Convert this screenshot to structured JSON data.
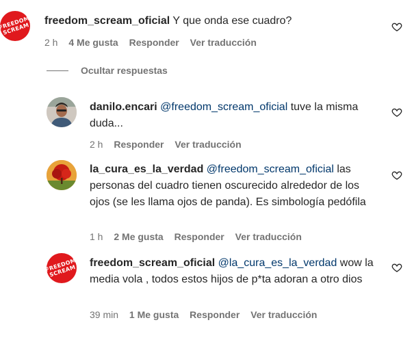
{
  "comments": [
    {
      "username": "freedom_scream_oficial",
      "mention": "",
      "text": "Y que onda ese cuadro?",
      "time": "2 h",
      "likes": "4 Me gusta",
      "reply": "Responder",
      "translate": "Ver traducción",
      "avatar": "freedom-scream-logo",
      "avatar_text": "FREEDOM SCREAM"
    },
    {
      "username": "danilo.encari",
      "mention": "@freedom_scream_oficial",
      "text": "tuve la misma duda...",
      "time": "2 h",
      "likes": "",
      "reply": "Responder",
      "translate": "Ver traducción",
      "avatar": "person-photo"
    },
    {
      "username": "la_cura_es_la_verdad",
      "mention": "@freedom_scream_oficial",
      "text": "las personas del cuadro tienen oscurecido alrededor de los ojos (se les llama ojos de panda). Es simbología pedófila",
      "time": "1 h",
      "likes": "2 Me gusta",
      "reply": "Responder",
      "translate": "Ver traducción",
      "avatar": "red-tree"
    },
    {
      "username": "freedom_scream_oficial",
      "mention": "@la_cura_es_la_verdad",
      "text": "wow la media vola , todos estos hijos de p*ta adoran a otro dios",
      "time": "39 min",
      "likes": "1 Me gusta",
      "reply": "Responder",
      "translate": "Ver traducción",
      "avatar": "freedom-scream-logo",
      "avatar_text": "FREEDOM SCREAM"
    }
  ],
  "replies_toggle": "Ocultar respuestas",
  "icons": {
    "like": "heart-icon"
  },
  "colors": {
    "mention": "#00376b",
    "meta": "#737373",
    "logo_red": "#e0191d"
  }
}
